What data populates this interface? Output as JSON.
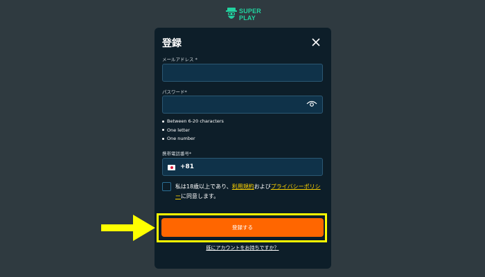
{
  "logo": {
    "line1": "SUPER",
    "line2": "PLAY"
  },
  "modal": {
    "title": "登録",
    "email": {
      "label": "メールアドレス *",
      "value": ""
    },
    "password": {
      "label": "パスワード*",
      "value": "",
      "rules": [
        "Between 6-20 characters",
        "One letter",
        "One number"
      ]
    },
    "phone": {
      "label": "携帯電話番号*",
      "code": "+81"
    },
    "agree": {
      "prefix": "私は18歳以上であり、",
      "terms": "利用規約",
      "middle": "および",
      "privacy": "プライバシーポリシー",
      "suffix": "に同意します。",
      "checked": false
    },
    "submit_label": "登録する",
    "login_link": "既にアカウントをお持ちですか？"
  },
  "colors": {
    "accent": "#ff6600",
    "link": "#ffd400",
    "highlight": "#ffff00",
    "arrow": "#ffff00"
  }
}
